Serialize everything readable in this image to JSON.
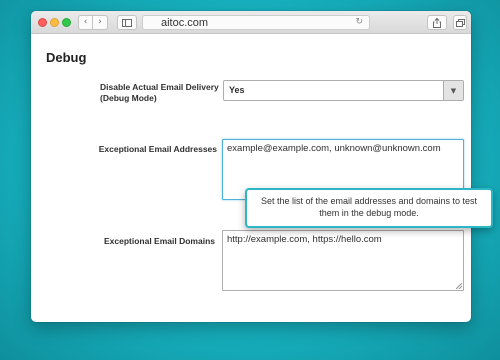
{
  "browser": {
    "url": "aitoc.com",
    "icons": {
      "back": "chevron-left-icon",
      "forward": "chevron-right-icon",
      "sidebar": "sidebar-icon",
      "reload": "reload-icon",
      "share": "share-icon",
      "tabs": "tabs-icon",
      "new_tab": "plus-icon"
    }
  },
  "page": {
    "title": "Debug"
  },
  "fields": {
    "disable_delivery": {
      "label": "Disable Actual Email Delivery (Debug Mode)",
      "value": "Yes"
    },
    "exceptional_emails": {
      "label": "Exceptional Email Addresses",
      "value": "example@example.com, unknown@unknown.com"
    },
    "exceptional_domains": {
      "label": "Exceptional Email Domains",
      "value": "http://example.com, https://hello.com"
    }
  },
  "tooltip": {
    "text": "Set the list of the email addresses and domains to test them in the debug mode."
  },
  "colors": {
    "background": "#17b2c0",
    "accent": "#2cb7c6",
    "focus_border": "#4fb3d6"
  }
}
